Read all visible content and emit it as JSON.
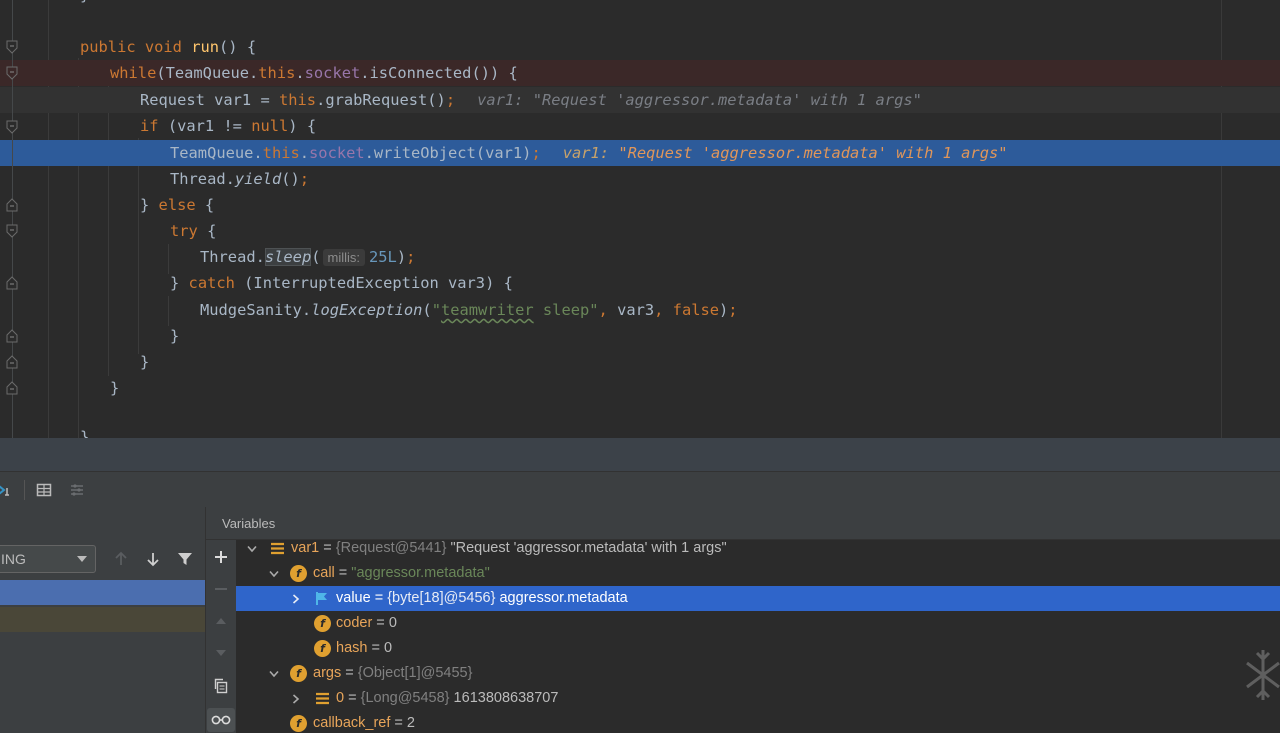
{
  "editor": {
    "lines": [
      {
        "id": "l1",
        "parts": [
          {
            "c": "kw",
            "t": "public "
          },
          {
            "c": "kw",
            "t": "void "
          },
          {
            "c": "fn",
            "t": "run"
          },
          {
            "c": "",
            "t": "() {"
          }
        ]
      },
      {
        "id": "l2",
        "parts": [
          {
            "c": "kw",
            "t": "while"
          },
          {
            "c": "",
            "t": "(TeamQueue."
          },
          {
            "c": "kw",
            "t": "this"
          },
          {
            "c": "",
            "t": "."
          },
          {
            "c": "fld",
            "t": "socket"
          },
          {
            "c": "",
            "t": ".isConnected()) {"
          }
        ]
      },
      {
        "id": "l3",
        "parts": [
          {
            "c": "",
            "t": "Request var1 = "
          },
          {
            "c": "kw",
            "t": "this"
          },
          {
            "c": "",
            "t": ".grabRequest()"
          },
          {
            "c": "kw",
            "t": ";"
          }
        ]
      },
      {
        "id": "l4",
        "parts": [
          {
            "c": "kw",
            "t": "if "
          },
          {
            "c": "",
            "t": "(var1 != "
          },
          {
            "c": "kw",
            "t": "null"
          },
          {
            "c": "",
            "t": ") {"
          }
        ]
      },
      {
        "id": "l5",
        "parts": [
          {
            "c": "",
            "t": "TeamQueue."
          },
          {
            "c": "kw",
            "t": "this"
          },
          {
            "c": "",
            "t": "."
          },
          {
            "c": "fld",
            "t": "socket"
          },
          {
            "c": "",
            "t": ".writeObject(var1)"
          },
          {
            "c": "kw",
            "t": ";"
          }
        ]
      },
      {
        "id": "l6",
        "parts": [
          {
            "c": "",
            "t": "Thread."
          },
          {
            "c": "it",
            "t": "yield"
          },
          {
            "c": "",
            "t": "()"
          },
          {
            "c": "kw",
            "t": ";"
          }
        ]
      },
      {
        "id": "l7",
        "parts": [
          {
            "c": "",
            "t": "} "
          },
          {
            "c": "kw",
            "t": "else "
          },
          {
            "c": "",
            "t": "{"
          }
        ]
      },
      {
        "id": "l8",
        "parts": [
          {
            "c": "kw",
            "t": "try "
          },
          {
            "c": "",
            "t": "{"
          }
        ]
      },
      {
        "id": "l9a",
        "parts": [
          {
            "c": "",
            "t": "Thread."
          },
          {
            "c": "it hl-usage",
            "t": "sleep"
          },
          {
            "c": "",
            "t": "("
          }
        ]
      },
      {
        "id": "l9b",
        "parts": [
          {
            "c": "num",
            "t": "25L"
          },
          {
            "c": "",
            "t": ")"
          },
          {
            "c": "kw",
            "t": ";"
          }
        ]
      },
      {
        "id": "l10",
        "parts": [
          {
            "c": "",
            "t": "} "
          },
          {
            "c": "kw",
            "t": "catch "
          },
          {
            "c": "",
            "t": "(InterruptedException var3) {"
          }
        ]
      },
      {
        "id": "l11a",
        "parts": [
          {
            "c": "",
            "t": "MudgeSanity."
          },
          {
            "c": "it",
            "t": "logException"
          },
          {
            "c": "",
            "t": "("
          },
          {
            "c": "str",
            "t": "\""
          }
        ]
      },
      {
        "id": "l11b",
        "parts": [
          {
            "c": "str typo",
            "t": "teamwriter"
          }
        ]
      },
      {
        "id": "l11c",
        "parts": [
          {
            "c": "str",
            "t": " sleep\""
          },
          {
            "c": "kw",
            "t": ", "
          },
          {
            "c": "",
            "t": "var3"
          },
          {
            "c": "kw",
            "t": ", false"
          },
          {
            "c": "",
            "t": ")"
          },
          {
            "c": "kw",
            "t": ";"
          }
        ]
      },
      {
        "id": "l12",
        "parts": [
          {
            "c": "",
            "t": "}"
          }
        ]
      },
      {
        "id": "l13",
        "parts": [
          {
            "c": "",
            "t": "}"
          }
        ]
      },
      {
        "id": "l14",
        "parts": [
          {
            "c": "",
            "t": "}"
          }
        ]
      }
    ],
    "inline_var": "var1: ",
    "inline_value": "\"Request 'aggressor.metadata' with 1 args\"",
    "param_hint": "millis:"
  },
  "frames": {
    "thread_value": "ING"
  },
  "variables": {
    "title": "Variables",
    "rows": [
      {
        "name": "var1",
        "eq": " = ",
        "type": "{Request@5441}",
        "val": " \"Request 'aggressor.metadata' with 1 args\""
      },
      {
        "name": "call",
        "eq": " = ",
        "type": "",
        "val": "\"aggressor.metadata\""
      },
      {
        "name": "value",
        "eq": " = ",
        "type": "{byte[18]@5456}",
        "val": " aggressor.metadata"
      },
      {
        "name": "coder",
        "eq": " = ",
        "type": "",
        "val": "0"
      },
      {
        "name": "hash",
        "eq": " = ",
        "type": "",
        "val": "0"
      },
      {
        "name": "args",
        "eq": " = ",
        "type": "{Object[1]@5455}",
        "val": ""
      },
      {
        "name": "0",
        "eq": " = ",
        "type": "{Long@5458}",
        "val": " 1613808638707"
      },
      {
        "name": "callback_ref",
        "eq": " = ",
        "type": "",
        "val": "2"
      }
    ]
  },
  "colors": {
    "execution_line": "#2d5b9a",
    "breakpoint_line": "#3b2828",
    "selected_row": "#2f65ca",
    "field_icon": "#e0a030"
  }
}
